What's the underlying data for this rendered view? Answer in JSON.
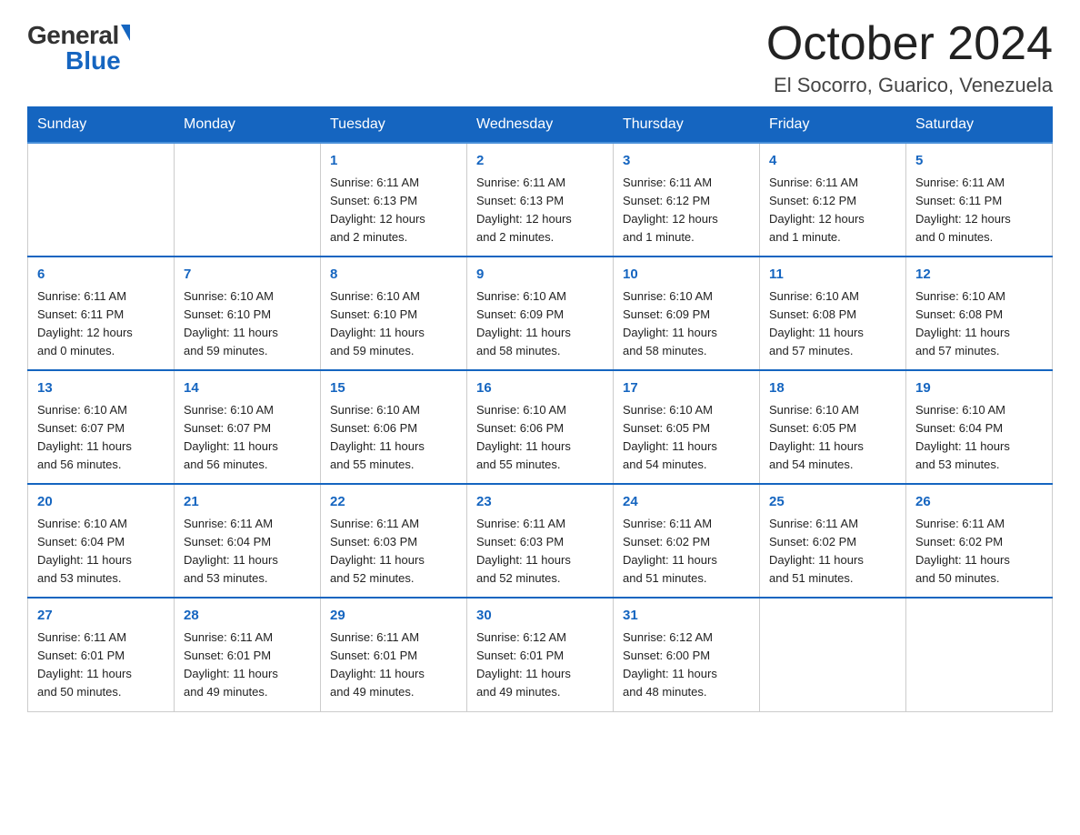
{
  "header": {
    "logo_general": "General",
    "logo_blue": "Blue",
    "month_title": "October 2024",
    "location": "El Socorro, Guarico, Venezuela"
  },
  "days_of_week": [
    "Sunday",
    "Monday",
    "Tuesday",
    "Wednesday",
    "Thursday",
    "Friday",
    "Saturday"
  ],
  "weeks": [
    [
      {
        "day": "",
        "info": ""
      },
      {
        "day": "",
        "info": ""
      },
      {
        "day": "1",
        "info": "Sunrise: 6:11 AM\nSunset: 6:13 PM\nDaylight: 12 hours\nand 2 minutes."
      },
      {
        "day": "2",
        "info": "Sunrise: 6:11 AM\nSunset: 6:13 PM\nDaylight: 12 hours\nand 2 minutes."
      },
      {
        "day": "3",
        "info": "Sunrise: 6:11 AM\nSunset: 6:12 PM\nDaylight: 12 hours\nand 1 minute."
      },
      {
        "day": "4",
        "info": "Sunrise: 6:11 AM\nSunset: 6:12 PM\nDaylight: 12 hours\nand 1 minute."
      },
      {
        "day": "5",
        "info": "Sunrise: 6:11 AM\nSunset: 6:11 PM\nDaylight: 12 hours\nand 0 minutes."
      }
    ],
    [
      {
        "day": "6",
        "info": "Sunrise: 6:11 AM\nSunset: 6:11 PM\nDaylight: 12 hours\nand 0 minutes."
      },
      {
        "day": "7",
        "info": "Sunrise: 6:10 AM\nSunset: 6:10 PM\nDaylight: 11 hours\nand 59 minutes."
      },
      {
        "day": "8",
        "info": "Sunrise: 6:10 AM\nSunset: 6:10 PM\nDaylight: 11 hours\nand 59 minutes."
      },
      {
        "day": "9",
        "info": "Sunrise: 6:10 AM\nSunset: 6:09 PM\nDaylight: 11 hours\nand 58 minutes."
      },
      {
        "day": "10",
        "info": "Sunrise: 6:10 AM\nSunset: 6:09 PM\nDaylight: 11 hours\nand 58 minutes."
      },
      {
        "day": "11",
        "info": "Sunrise: 6:10 AM\nSunset: 6:08 PM\nDaylight: 11 hours\nand 57 minutes."
      },
      {
        "day": "12",
        "info": "Sunrise: 6:10 AM\nSunset: 6:08 PM\nDaylight: 11 hours\nand 57 minutes."
      }
    ],
    [
      {
        "day": "13",
        "info": "Sunrise: 6:10 AM\nSunset: 6:07 PM\nDaylight: 11 hours\nand 56 minutes."
      },
      {
        "day": "14",
        "info": "Sunrise: 6:10 AM\nSunset: 6:07 PM\nDaylight: 11 hours\nand 56 minutes."
      },
      {
        "day": "15",
        "info": "Sunrise: 6:10 AM\nSunset: 6:06 PM\nDaylight: 11 hours\nand 55 minutes."
      },
      {
        "day": "16",
        "info": "Sunrise: 6:10 AM\nSunset: 6:06 PM\nDaylight: 11 hours\nand 55 minutes."
      },
      {
        "day": "17",
        "info": "Sunrise: 6:10 AM\nSunset: 6:05 PM\nDaylight: 11 hours\nand 54 minutes."
      },
      {
        "day": "18",
        "info": "Sunrise: 6:10 AM\nSunset: 6:05 PM\nDaylight: 11 hours\nand 54 minutes."
      },
      {
        "day": "19",
        "info": "Sunrise: 6:10 AM\nSunset: 6:04 PM\nDaylight: 11 hours\nand 53 minutes."
      }
    ],
    [
      {
        "day": "20",
        "info": "Sunrise: 6:10 AM\nSunset: 6:04 PM\nDaylight: 11 hours\nand 53 minutes."
      },
      {
        "day": "21",
        "info": "Sunrise: 6:11 AM\nSunset: 6:04 PM\nDaylight: 11 hours\nand 53 minutes."
      },
      {
        "day": "22",
        "info": "Sunrise: 6:11 AM\nSunset: 6:03 PM\nDaylight: 11 hours\nand 52 minutes."
      },
      {
        "day": "23",
        "info": "Sunrise: 6:11 AM\nSunset: 6:03 PM\nDaylight: 11 hours\nand 52 minutes."
      },
      {
        "day": "24",
        "info": "Sunrise: 6:11 AM\nSunset: 6:02 PM\nDaylight: 11 hours\nand 51 minutes."
      },
      {
        "day": "25",
        "info": "Sunrise: 6:11 AM\nSunset: 6:02 PM\nDaylight: 11 hours\nand 51 minutes."
      },
      {
        "day": "26",
        "info": "Sunrise: 6:11 AM\nSunset: 6:02 PM\nDaylight: 11 hours\nand 50 minutes."
      }
    ],
    [
      {
        "day": "27",
        "info": "Sunrise: 6:11 AM\nSunset: 6:01 PM\nDaylight: 11 hours\nand 50 minutes."
      },
      {
        "day": "28",
        "info": "Sunrise: 6:11 AM\nSunset: 6:01 PM\nDaylight: 11 hours\nand 49 minutes."
      },
      {
        "day": "29",
        "info": "Sunrise: 6:11 AM\nSunset: 6:01 PM\nDaylight: 11 hours\nand 49 minutes."
      },
      {
        "day": "30",
        "info": "Sunrise: 6:12 AM\nSunset: 6:01 PM\nDaylight: 11 hours\nand 49 minutes."
      },
      {
        "day": "31",
        "info": "Sunrise: 6:12 AM\nSunset: 6:00 PM\nDaylight: 11 hours\nand 48 minutes."
      },
      {
        "day": "",
        "info": ""
      },
      {
        "day": "",
        "info": ""
      }
    ]
  ]
}
